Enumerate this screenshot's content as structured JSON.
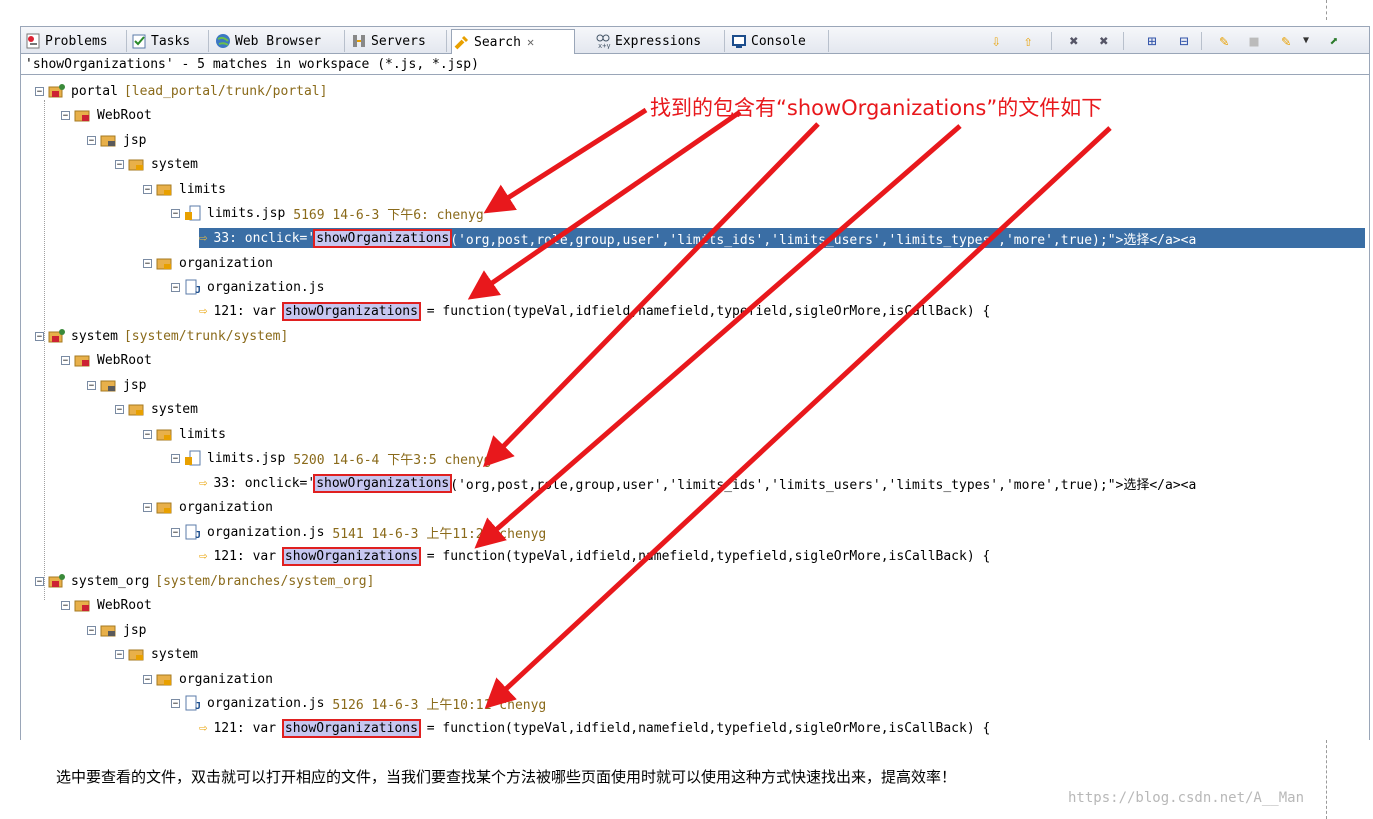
{
  "tabs": [
    {
      "label": "Problems",
      "icon": "problems-icon"
    },
    {
      "label": "Tasks",
      "icon": "tasks-icon"
    },
    {
      "label": "Web Browser",
      "icon": "globe-icon"
    },
    {
      "label": "Servers",
      "icon": "servers-icon"
    },
    {
      "label": "Search",
      "icon": "search-flashlight-icon",
      "active": true,
      "close": "✕"
    },
    {
      "label": "Expressions",
      "icon": "expressions-icon"
    },
    {
      "label": "Console",
      "icon": "console-icon"
    }
  ],
  "toolbar": [
    "next-match-icon",
    "previous-match-icon",
    "remove-match-icon",
    "remove-all-matches-icon",
    "expand-all-icon",
    "collapse-all-icon",
    "search-again-icon",
    "cancel-search-icon",
    "search-history-icon",
    "view-menu-icon",
    "pin-icon"
  ],
  "summary": "'showOrganizations' - 5 matches in workspace (*.js, *.jsp)",
  "tree": {
    "portal": {
      "name": "portal",
      "path": "[lead_portal/trunk/portal]"
    },
    "webroot": "WebRoot",
    "jsp": "jsp",
    "system_folder": "system",
    "limits_folder": "limits",
    "organization_folder": "organization",
    "system_project": {
      "name": "system",
      "path": "[system/trunk/system]"
    },
    "system_org_project": {
      "name": "system_org",
      "path": "[system/branches/system_org]"
    },
    "files": {
      "limits1": {
        "name": "limits.jsp",
        "meta": "5169  14-6-3 下午6:   chenyg"
      },
      "org1": {
        "name": "organization.js"
      },
      "limits2": {
        "name": "limits.jsp",
        "meta": "5200  14-6-4 下午3:5   chenyg"
      },
      "org2": {
        "name": "organization.js",
        "meta": "5141  14-6-3 上午11:23  chenyg"
      },
      "org3": {
        "name": "organization.js",
        "meta": "5126  14-6-3 上午10:11  chenyg"
      }
    },
    "matches": {
      "m1": {
        "line": "33:",
        "pre": "onclick='",
        "term": "showOrganizations",
        "post": "('org,post,role,group,user','limits_ids','limits_users','limits_types','more',true);\">选择</a><a"
      },
      "m2": {
        "line": "121:",
        "pre": "var",
        "term": "showOrganizations",
        "post": "= function(typeVal,idfield,namefield,typefield,sigleOrMore,isCallBack) {"
      },
      "m3": {
        "line": "33:",
        "pre": "onclick='",
        "term": "showOrganizations",
        "post": "('org,post,role,group,user','limits_ids','limits_users','limits_types','more',true);\">选择</a><a"
      },
      "m4": {
        "line": "121:",
        "pre": "var",
        "term": "showOrganizations",
        "post": "= function(typeVal,idfield,namefield,typefield,sigleOrMore,isCallBack) {"
      },
      "m5": {
        "line": "121:",
        "pre": "var",
        "term": "showOrganizations",
        "post": "= function(typeVal,idfield,namefield,typefield,sigleOrMore,isCallBack) {"
      }
    }
  },
  "annotation": "找到的包含有“showOrganizations”的文件如下",
  "note": "选中要查看的文件，双击就可以打开相应的文件，当我们要查找某个方法被哪些页面使用时就可以使用这种方式快速找出来，提高效率！",
  "watermark": "https://blog.csdn.net/A__Man",
  "colors": {
    "selection": "#3a6ea5",
    "highlight": "#c6c6f0",
    "annotation": "#e8181c",
    "path": "#8a6a1a"
  }
}
